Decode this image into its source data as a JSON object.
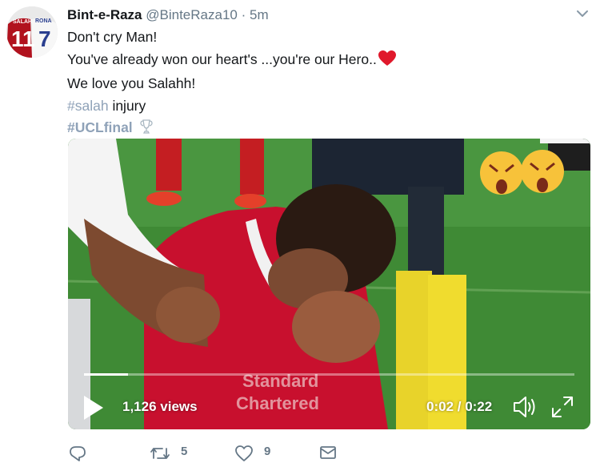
{
  "tweet": {
    "author": {
      "name": "Bint-e-Raza",
      "handle": "@BinteRaza10",
      "separator": "·",
      "time": "5m"
    },
    "avatar_jersey_text": [
      "SALAH",
      "RONA",
      "11",
      "7"
    ],
    "lines": {
      "l1": "Don't cry Man!",
      "l2": "You've already won our heart's ...you're our Hero..",
      "l3": "We love you Salahh!",
      "l4_tag": "#salah",
      "l4_rest": " injury",
      "l5_tag": "#UCLfinal"
    },
    "icons": {
      "menu": "chevron-down-icon",
      "heart_emoji": "red-heart-icon",
      "trophy": "trophy-icon",
      "reply": "reply-icon",
      "retweet": "retweet-icon",
      "like": "like-icon",
      "dm": "mail-icon",
      "play": "play-icon",
      "volume": "volume-icon",
      "fullscreen": "fullscreen-icon"
    }
  },
  "video": {
    "views": "1,126 views",
    "time": "0:02 / 0:22",
    "progress": 0.09,
    "shirt_text": [
      "Standard",
      "Chartered"
    ]
  },
  "actions": {
    "retweets": "5",
    "likes": "9"
  },
  "colors": {
    "tag": "#8fa2b8",
    "meta": "#657786",
    "liverpool_red": "#c8102e",
    "pitch": "#3f8a35"
  }
}
